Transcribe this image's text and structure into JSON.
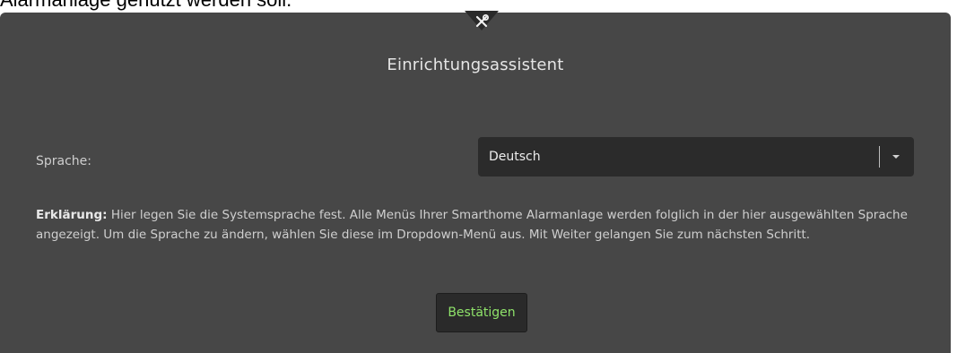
{
  "caption": "Alarmanlage genutzt werden soll.",
  "dialog": {
    "title": "Einrichtungsassistent",
    "header_icon": "tools-icon"
  },
  "language": {
    "label": "Sprache:",
    "selected": "Deutsch"
  },
  "explanation": {
    "prefix": "Erklärung:",
    "text": " Hier legen Sie die Systemsprache fest. Alle Menüs Ihrer Smarthome Alarmanlage werden folglich in der hier ausgewählten Sprache angezeigt. Um die Sprache zu ändern, wählen Sie diese im Dropdown-Menü aus. Mit Weiter gelangen Sie zum nächsten Schritt."
  },
  "actions": {
    "confirm_label": "Bestätigen"
  },
  "colors": {
    "panel": "#474747",
    "field": "#2b2b2b",
    "accent_green": "#8fe36a"
  }
}
